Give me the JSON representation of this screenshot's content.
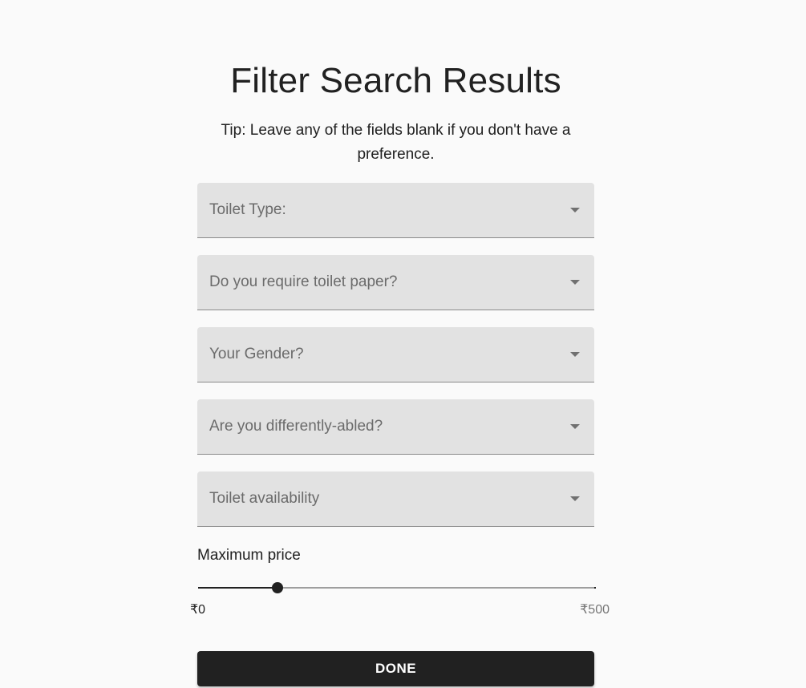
{
  "header": {
    "title": "Filter Search Results",
    "tip": "Tip: Leave any of the fields blank if you don't have a preference."
  },
  "filters": [
    {
      "label": "Toilet Type:",
      "value": ""
    },
    {
      "label": "Do you require toilet paper?",
      "value": ""
    },
    {
      "label": "Your Gender?",
      "value": ""
    },
    {
      "label": "Are you differently-abled?",
      "value": ""
    },
    {
      "label": "Toilet availability",
      "value": ""
    }
  ],
  "price": {
    "label": "Maximum price",
    "min_label": "₹0",
    "max_label": "₹500",
    "min": 0,
    "max": 500,
    "value": 100
  },
  "actions": {
    "done_label": "DONE"
  },
  "icons": {
    "dropdown": "caret-down-icon"
  },
  "colors": {
    "background": "#fafafa",
    "field_background": "#e2e2e2",
    "primary": "#212121",
    "button_text": "#ffffff"
  }
}
